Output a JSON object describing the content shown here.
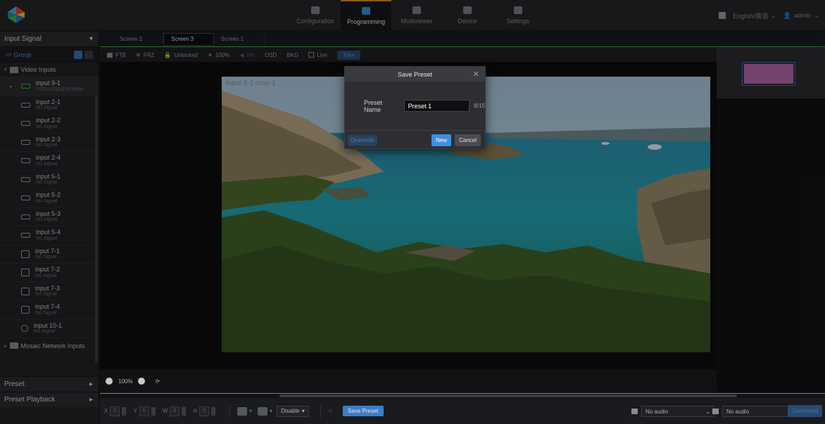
{
  "nav": {
    "tabs": [
      {
        "label": "Configuration",
        "icon": "configuration-icon"
      },
      {
        "label": "Programming",
        "icon": "programming-icon"
      },
      {
        "label": "Multiviewer",
        "icon": "multiviewer-icon"
      },
      {
        "label": "Device",
        "icon": "device-icon"
      },
      {
        "label": "Settings",
        "icon": "settings-icon"
      }
    ],
    "active_tab": "Programming",
    "language": "English/英语",
    "user": "admin"
  },
  "sidebar": {
    "header": "Input Signal",
    "group_label": "Group",
    "video_inputs_label": "Video Inputs",
    "items": [
      {
        "name": "input 9-1",
        "signal": "1920x1080@59.94Hz",
        "icon": "hdmi-port-icon"
      },
      {
        "name": "input 2-1",
        "signal": "No Signal",
        "icon": "hdmi-port-icon"
      },
      {
        "name": "input 2-2",
        "signal": "No Signal",
        "icon": "hdmi-port-icon"
      },
      {
        "name": "input 2-3",
        "signal": "No Signal",
        "icon": "hdmi-port-icon"
      },
      {
        "name": "input 2-4",
        "signal": "No Signal",
        "icon": "hdmi-port-icon"
      },
      {
        "name": "input 5-1",
        "signal": "No Signal",
        "icon": "hdmi-port-icon"
      },
      {
        "name": "input 5-2",
        "signal": "No Signal",
        "icon": "hdmi-port-icon"
      },
      {
        "name": "input 5-3",
        "signal": "No Signal",
        "icon": "hdmi-port-icon"
      },
      {
        "name": "input 5-4",
        "signal": "No Signal",
        "icon": "hdmi-port-icon"
      },
      {
        "name": "input 7-1",
        "signal": "No Signal",
        "icon": "dvi-port-icon"
      },
      {
        "name": "input 7-2",
        "signal": "No Signal",
        "icon": "dvi-port-icon"
      },
      {
        "name": "input 7-3",
        "signal": "No Signal",
        "icon": "dvi-port-icon"
      },
      {
        "name": "input 7-4",
        "signal": "No Signal",
        "icon": "dvi-port-icon"
      },
      {
        "name": "input 10-1",
        "signal": "No Signal",
        "icon": "sdi-port-icon"
      }
    ],
    "mosaic_label": "Mosaic Network Inputs",
    "preset_label": "Preset",
    "preset_playback_label": "Preset Playback"
  },
  "screens": {
    "tabs": [
      "Screen 2",
      "Screen 3",
      "Screen 1"
    ],
    "active": "Screen 3"
  },
  "toolbar": {
    "ftb": "FTB",
    "frz": "FRZ",
    "unlocked": "Unlocked",
    "brightness": "100%",
    "volume": "0%",
    "osd": "OSD",
    "bkg": "BKG",
    "live": "Live",
    "take": "Take"
  },
  "canvas": {
    "layer_label": "input 9-1-crop-1",
    "zoom": "100%"
  },
  "bottom": {
    "x_label": "X",
    "y_label": "Y",
    "w_label": "W",
    "h_label": "H",
    "x_value": "0",
    "y_value": "0",
    "w_value": "0",
    "h_value": "0",
    "disable_label": "Disable",
    "save_preset": "Save Preset",
    "audio1": "No audio",
    "audio2": "No audio",
    "command": "Command"
  },
  "dialog": {
    "title": "Save Preset",
    "field_label": "Preset Name",
    "field_value": "Preset 1",
    "char_count": "8/15",
    "overwrite": "Overwrite",
    "new": "New",
    "cancel": "Cancel"
  },
  "colors": {
    "accent": "#3b8cd9",
    "active_tab_border": "#d98b1a",
    "canvas_border": "#3fae4a",
    "screen_tab_border": "#7a2a2a"
  }
}
